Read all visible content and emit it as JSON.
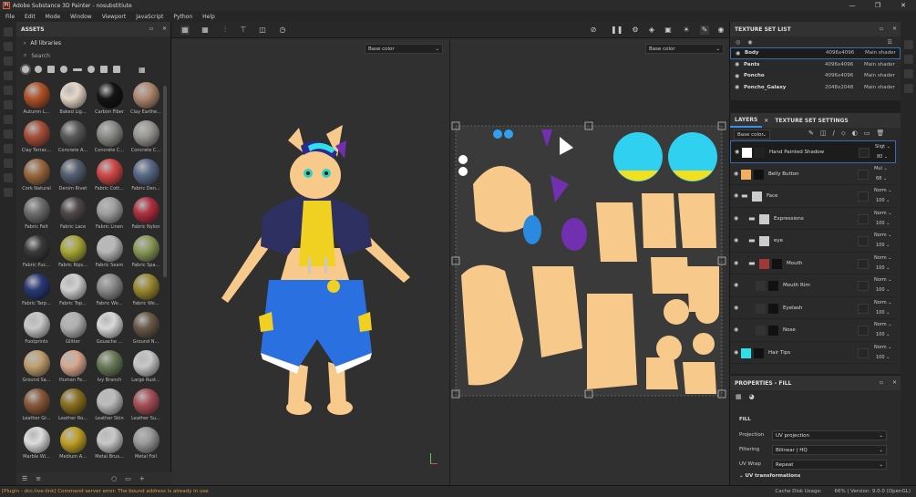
{
  "window": {
    "title": "Adobe Substance 3D Painter - nosubstitiute",
    "app_icon_label": "Pt",
    "controls": [
      "—",
      "❐",
      "✕"
    ]
  },
  "menu": [
    "File",
    "Edit",
    "Mode",
    "Window",
    "Viewport",
    "JavaScript",
    "Python",
    "Help"
  ],
  "assets": {
    "title": "ASSETS",
    "library": "All libraries",
    "search_placeholder": "Search",
    "materials": [
      {
        "label": "Autumn L...",
        "color": "#b0542a"
      },
      {
        "label": "Baked Lig...",
        "color": "#e6d8c8"
      },
      {
        "label": "Carbon Fiber",
        "color": "#151515"
      },
      {
        "label": "Clay Earthe...",
        "color": "#b08870"
      },
      {
        "label": "Clay Terrac...",
        "color": "#a8503a"
      },
      {
        "label": "Concrete A...",
        "color": "#5a5a5c"
      },
      {
        "label": "Concrete C...",
        "color": "#8a8a86"
      },
      {
        "label": "Concrete C...",
        "color": "#9a9894"
      },
      {
        "label": "Cork Natural",
        "color": "#9a6a40"
      },
      {
        "label": "Denim Rivet",
        "color": "#556070"
      },
      {
        "label": "Fabric Cott...",
        "color": "#d04848"
      },
      {
        "label": "Fabric Den...",
        "color": "#5a6a88"
      },
      {
        "label": "Fabric Felt",
        "color": "#6e6e6e"
      },
      {
        "label": "Fabric Lace",
        "color": "#504848"
      },
      {
        "label": "Fabric Linen",
        "color": "#a0a0a0"
      },
      {
        "label": "Fabric Nylon",
        "color": "#b03040"
      },
      {
        "label": "Fabric Puc...",
        "color": "#3a3a3a"
      },
      {
        "label": "Fabric Rips...",
        "color": "#a8a838"
      },
      {
        "label": "Fabric Seam",
        "color": "#b8b8b8"
      },
      {
        "label": "Fabric Spa...",
        "color": "#8a9a58"
      },
      {
        "label": "Fabric Tarp...",
        "color": "#2a3a78"
      },
      {
        "label": "Fabric Top...",
        "color": "#d0d0d0"
      },
      {
        "label": "Fabric Wo...",
        "color": "#8a8a8a"
      },
      {
        "label": "Fabric Wo...",
        "color": "#9a8a30"
      },
      {
        "label": "Footprints",
        "color": "#c8c8c8"
      },
      {
        "label": "Glitter",
        "color": "#b0b0b0"
      },
      {
        "label": "Gouache ...",
        "color": "#d8d8d8"
      },
      {
        "label": "Ground N...",
        "color": "#6a5a4a"
      },
      {
        "label": "Ground Sa...",
        "color": "#c0a070"
      },
      {
        "label": "Human Fe...",
        "color": "#d8a890"
      },
      {
        "label": "Ivy Branch",
        "color": "#6a7a58"
      },
      {
        "label": "Large Rust...",
        "color": "#c8c8c8"
      },
      {
        "label": "Leather Gr...",
        "color": "#8a5a3a"
      },
      {
        "label": "Leather Ro...",
        "color": "#8a7020"
      },
      {
        "label": "Leather Skin",
        "color": "#bcbcbc"
      },
      {
        "label": "Leather Su...",
        "color": "#a85058"
      },
      {
        "label": "Marble Wi...",
        "color": "#dcdcdc"
      },
      {
        "label": "Medium A...",
        "color": "#c0a028"
      },
      {
        "label": "Metal Brus...",
        "color": "#c8c8c8"
      },
      {
        "label": "Metal Foil",
        "color": "#9a9a9a"
      }
    ]
  },
  "viewport": {
    "channel_3d": "Base color",
    "channel_2d": "Base color"
  },
  "texture_set_list": {
    "title": "TEXTURE SET LIST",
    "rows": [
      {
        "name": "Body",
        "res": "4096x4096",
        "shader": "Main shader",
        "selected": true
      },
      {
        "name": "Pants",
        "res": "4096x4096",
        "shader": "Main shader",
        "selected": false
      },
      {
        "name": "Poncho",
        "res": "4096x4096",
        "shader": "Main shader",
        "selected": false
      },
      {
        "name": "Poncho_Galaxy",
        "res": "2048x2048",
        "shader": "Main shader",
        "selected": false
      }
    ]
  },
  "layers": {
    "tab_layers": "LAYERS",
    "tab_tss": "TEXTURE SET SETTINGS",
    "channel": "Base color",
    "rows": [
      {
        "name": "Hand Painted Shadow",
        "blend": "Sligt",
        "opacity": "80",
        "selected": true,
        "indent": 0,
        "thumb": "#ffffff",
        "mask": "#222222",
        "folder": false
      },
      {
        "name": "Belly Button",
        "blend": "Mul",
        "opacity": "68",
        "selected": false,
        "indent": 0,
        "thumb": "#f0b060",
        "mask": "#111111",
        "folder": false
      },
      {
        "name": "Face",
        "blend": "Norm",
        "opacity": "100",
        "selected": false,
        "indent": 0,
        "thumb": "#cccccc",
        "mask": "",
        "folder": true
      },
      {
        "name": "Expressions",
        "blend": "Norm",
        "opacity": "100",
        "selected": false,
        "indent": 1,
        "thumb": "#cccccc",
        "mask": "",
        "folder": true
      },
      {
        "name": "eye",
        "blend": "Norm",
        "opacity": "100",
        "selected": false,
        "indent": 1,
        "thumb": "#cccccc",
        "mask": "",
        "folder": true
      },
      {
        "name": "Mouth",
        "blend": "Norm",
        "opacity": "100",
        "selected": false,
        "indent": 1,
        "thumb": "#a03838",
        "mask": "#111111",
        "folder": true
      },
      {
        "name": "Mouth Rim",
        "blend": "Norm",
        "opacity": "100",
        "selected": false,
        "indent": 2,
        "thumb": "#333333",
        "mask": "#111111",
        "folder": false
      },
      {
        "name": "Eyelash",
        "blend": "Norm",
        "opacity": "100",
        "selected": false,
        "indent": 2,
        "thumb": "#333333",
        "mask": "#111111",
        "folder": false
      },
      {
        "name": "Nose",
        "blend": "Norm",
        "opacity": "100",
        "selected": false,
        "indent": 2,
        "thumb": "#333333",
        "mask": "#111111",
        "folder": false
      },
      {
        "name": "Hair Tips",
        "blend": "Norm",
        "opacity": "100",
        "selected": false,
        "indent": 0,
        "thumb": "#30e0e8",
        "mask": "#111111",
        "folder": false
      }
    ]
  },
  "properties": {
    "title": "PROPERTIES - FILL",
    "section": "FILL",
    "projection_label": "Projection",
    "projection": "UV projection",
    "filtering_label": "Filtering",
    "filtering": "Bilinear | HQ",
    "uvwrap_label": "UV Wrap",
    "uvwrap": "Repeat",
    "uv_transform": "UV transformations"
  },
  "status": {
    "error": "[Plugin - dcc-live-link] Command server error: The bound address is already in use",
    "cache_label": "Cache Disk Usage:",
    "cache_value": "66%",
    "version": "Version: 9.0.0 (OpenGL)"
  },
  "colors": {
    "accent": "#3d6bb3",
    "fur": "#f7c98a",
    "hoodie": "#2d3060",
    "yellow": "#f0d020",
    "shorts": "#2a70e0",
    "cyan": "#30e0e8"
  }
}
